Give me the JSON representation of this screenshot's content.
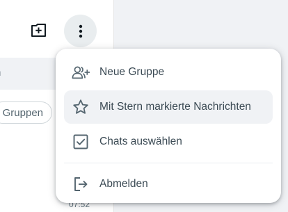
{
  "colors": {
    "accent_bg": "#e9edef",
    "panel_bg": "#f0f2f5",
    "text": "#3b4a54",
    "icon": "#54656f"
  },
  "header": {
    "new_chat_icon": "new-chat-icon",
    "menu_icon": "more-vertical-icon"
  },
  "search": {
    "partial_text": "n"
  },
  "filters": {
    "groups_label": "Gruppen"
  },
  "chat_list": {
    "partial_time": "07:52"
  },
  "menu": {
    "items": [
      {
        "label": "Neue Gruppe",
        "icon": "add-group-icon"
      },
      {
        "label": "Mit Stern markierte Nachrichten",
        "icon": "star-icon"
      },
      {
        "label": "Chats auswählen",
        "icon": "checkbox-icon"
      },
      {
        "label": "Abmelden",
        "icon": "logout-icon"
      }
    ]
  }
}
